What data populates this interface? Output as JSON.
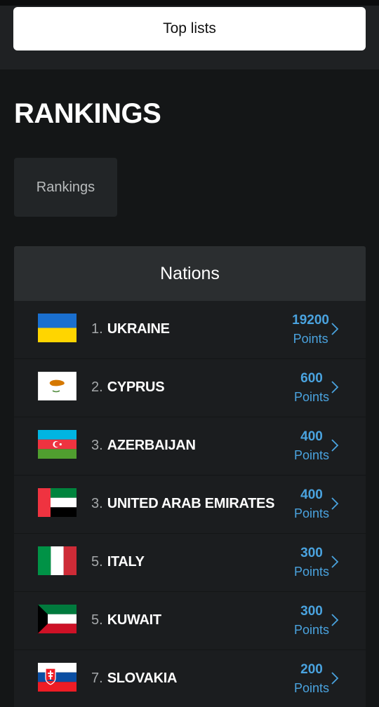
{
  "header": {
    "top_lists_label": "Top lists"
  },
  "page": {
    "title": "RANKINGS",
    "tab_label": "Rankings"
  },
  "panel": {
    "title": "Nations",
    "rows": [
      {
        "position": "1.",
        "country": "UKRAINE",
        "points": "19200",
        "points_label": "Points",
        "flag": "ukraine-flag-icon"
      },
      {
        "position": "2.",
        "country": "CYPRUS",
        "points": "600",
        "points_label": "Points",
        "flag": "cyprus-flag-icon"
      },
      {
        "position": "3.",
        "country": "AZERBAIJAN",
        "points": "400",
        "points_label": "Points",
        "flag": "azerbaijan-flag-icon"
      },
      {
        "position": "3.",
        "country": "UNITED ARAB EMIRATES",
        "points": "400",
        "points_label": "Points",
        "flag": "uae-flag-icon"
      },
      {
        "position": "5.",
        "country": "ITALY",
        "points": "300",
        "points_label": "Points",
        "flag": "italy-flag-icon"
      },
      {
        "position": "5.",
        "country": "KUWAIT",
        "points": "300",
        "points_label": "Points",
        "flag": "kuwait-flag-icon"
      },
      {
        "position": "7.",
        "country": "SLOVAKIA",
        "points": "200",
        "points_label": "Points",
        "flag": "slovakia-flag-icon"
      }
    ]
  },
  "colors": {
    "background": "#141617",
    "accent_points": "#4aa3df",
    "panel_header": "#2b2e30"
  }
}
